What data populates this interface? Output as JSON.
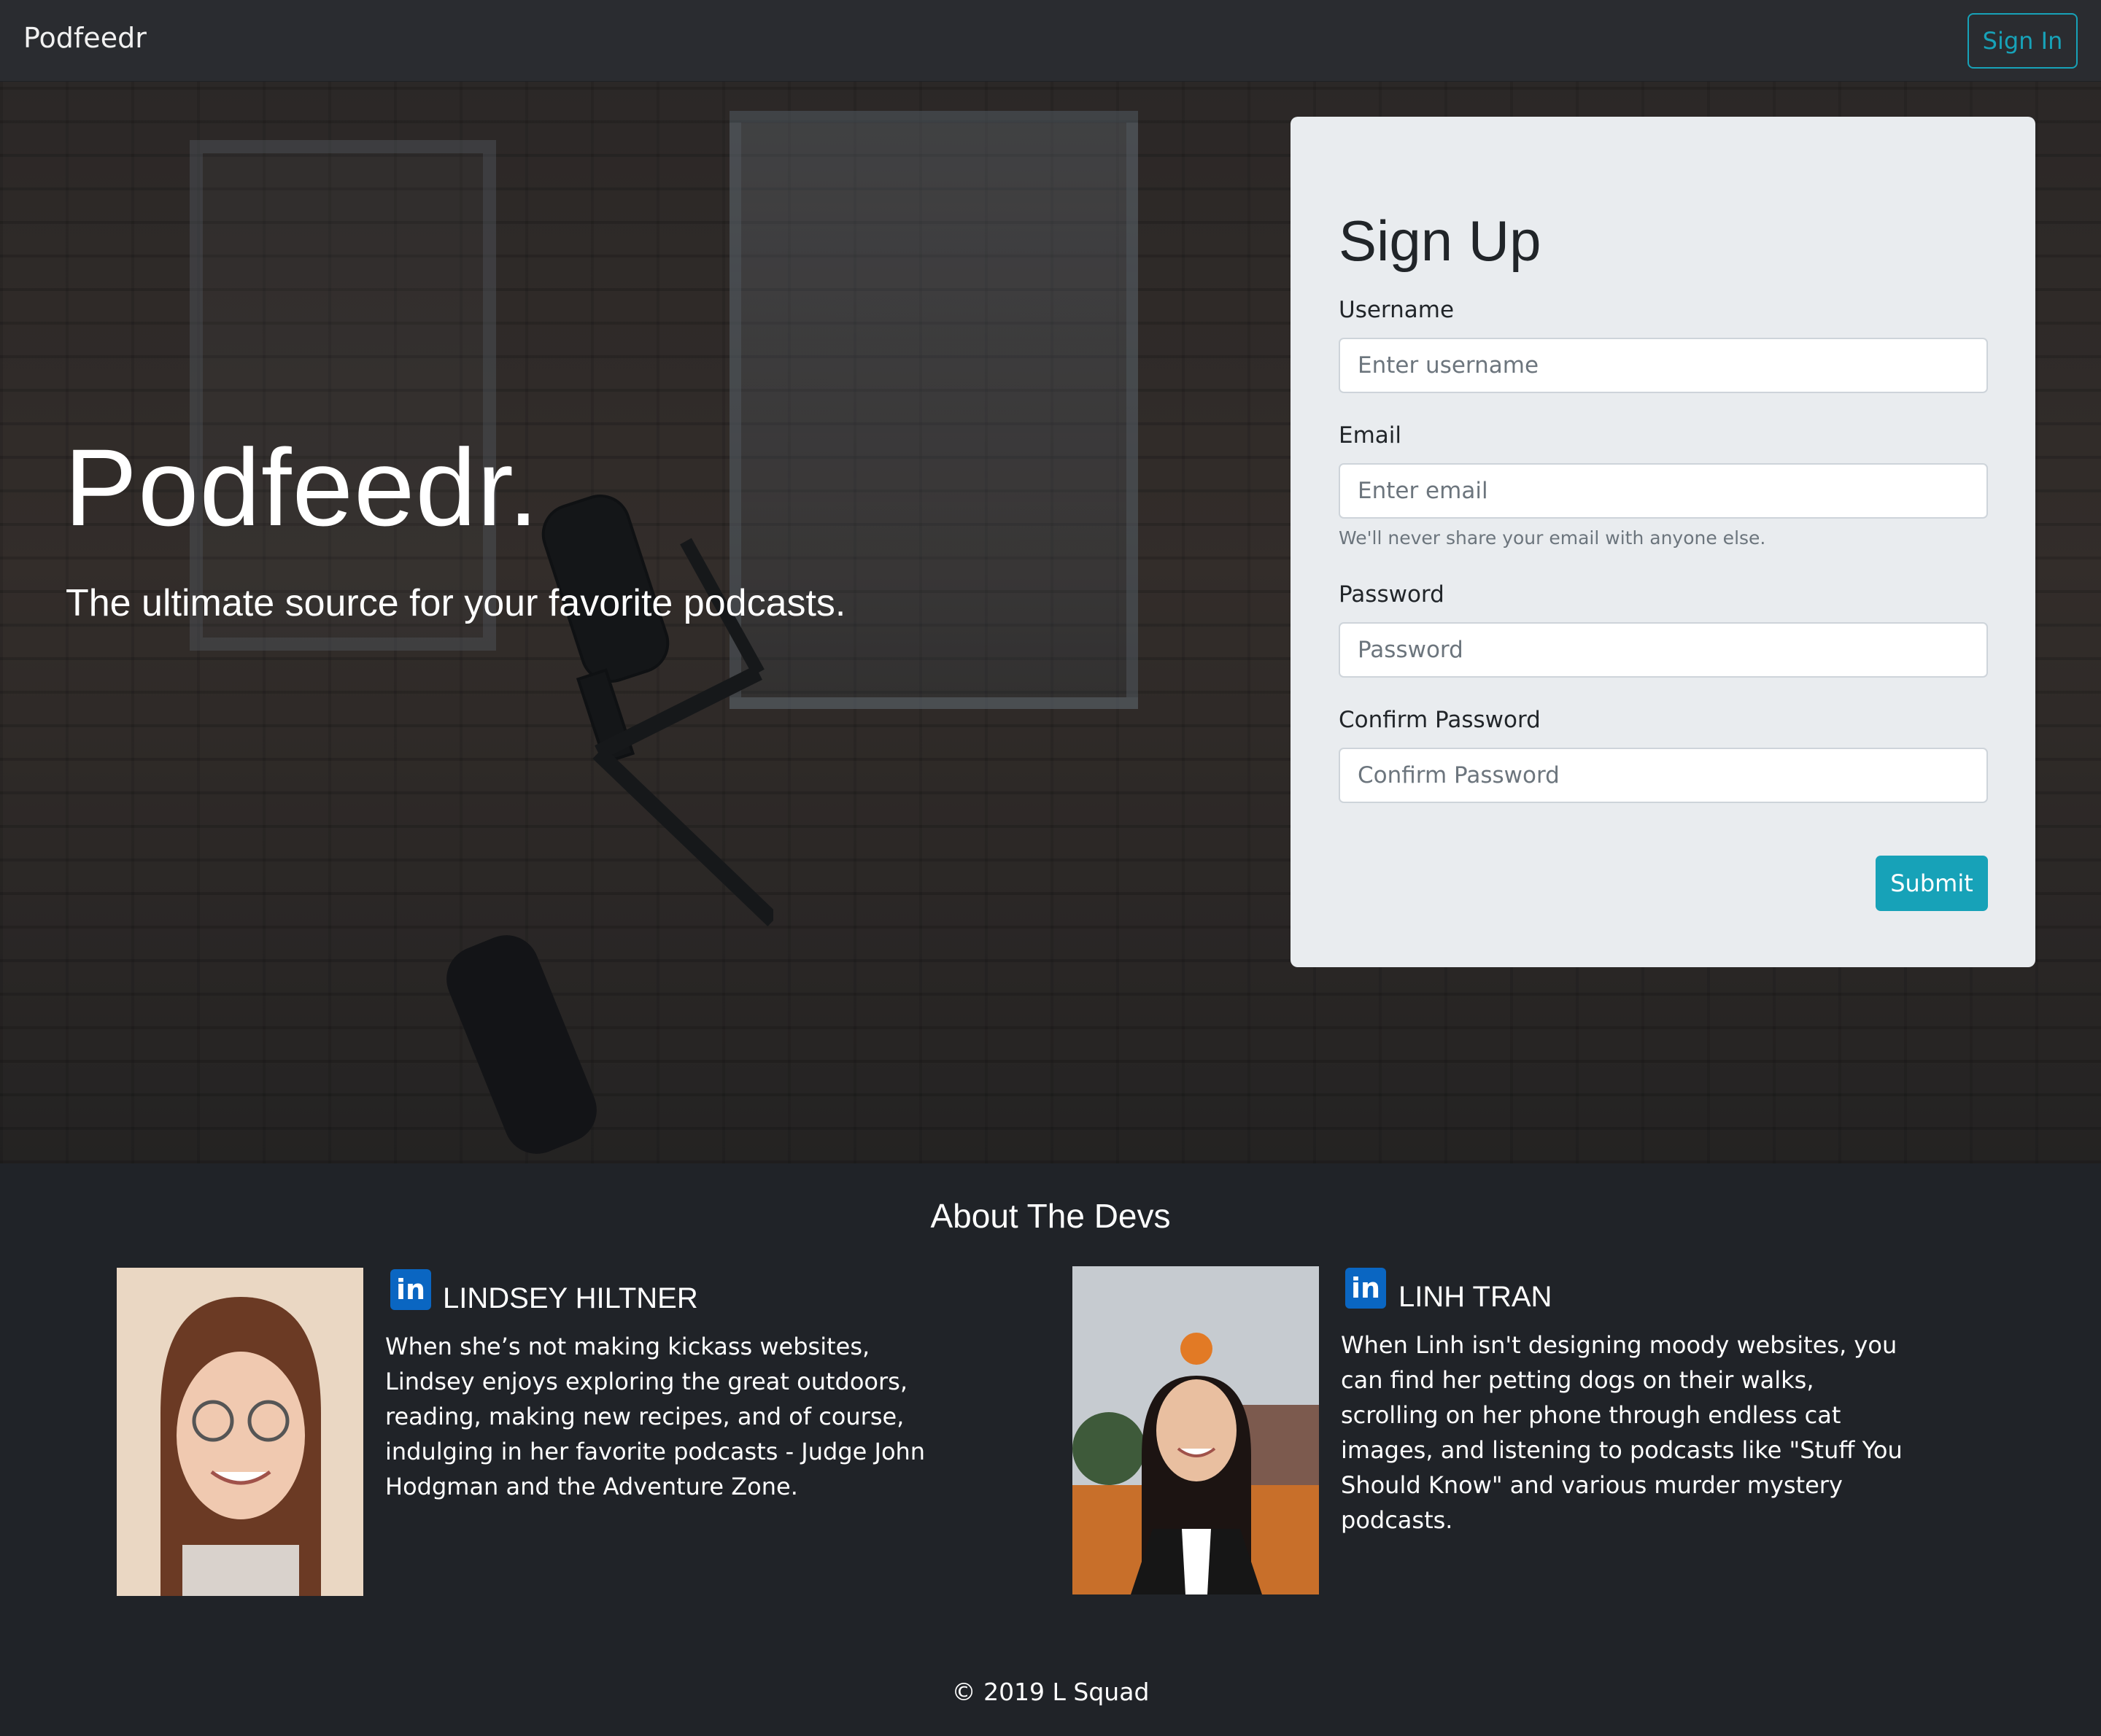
{
  "navbar": {
    "brand": "Podfeedr",
    "signin_label": "Sign In"
  },
  "hero": {
    "title": "Podfeedr.",
    "subtitle": "The ultimate source for your favorite podcasts."
  },
  "signup": {
    "title": "Sign Up",
    "username_label": "Username",
    "username_placeholder": "Enter username",
    "email_label": "Email",
    "email_placeholder": "Enter email",
    "email_help": "We'll never share your email with anyone else.",
    "password_label": "Password",
    "password_placeholder": "Password",
    "confirm_label": "Confirm Password",
    "confirm_placeholder": "Confirm Password",
    "submit_label": "Submit"
  },
  "about": {
    "title": "About The Devs",
    "devs": [
      {
        "name": "LINDSEY HILTNER",
        "bio": "When she’s not making kickass websites, Lindsey enjoys exploring the great outdoors, reading, making new recipes, and of course, indulging in her favorite podcasts - Judge John Hodgman and the Adventure Zone.",
        "icon": "linkedin-icon"
      },
      {
        "name": "LINH TRAN",
        "bio": "When Linh isn't designing moody websites, you can find her petting dogs on their walks, scrolling on her phone through endless cat images, and listening to podcasts like \"Stuff You Should Know\" and various murder mystery podcasts.",
        "icon": "linkedin-icon"
      }
    ]
  },
  "footer": {
    "copyright": "© 2019 L Squad"
  },
  "colors": {
    "accent": "#17a2b8",
    "background": "#202328",
    "card": "#e9ecef",
    "linkedin": "#0a66c2"
  }
}
